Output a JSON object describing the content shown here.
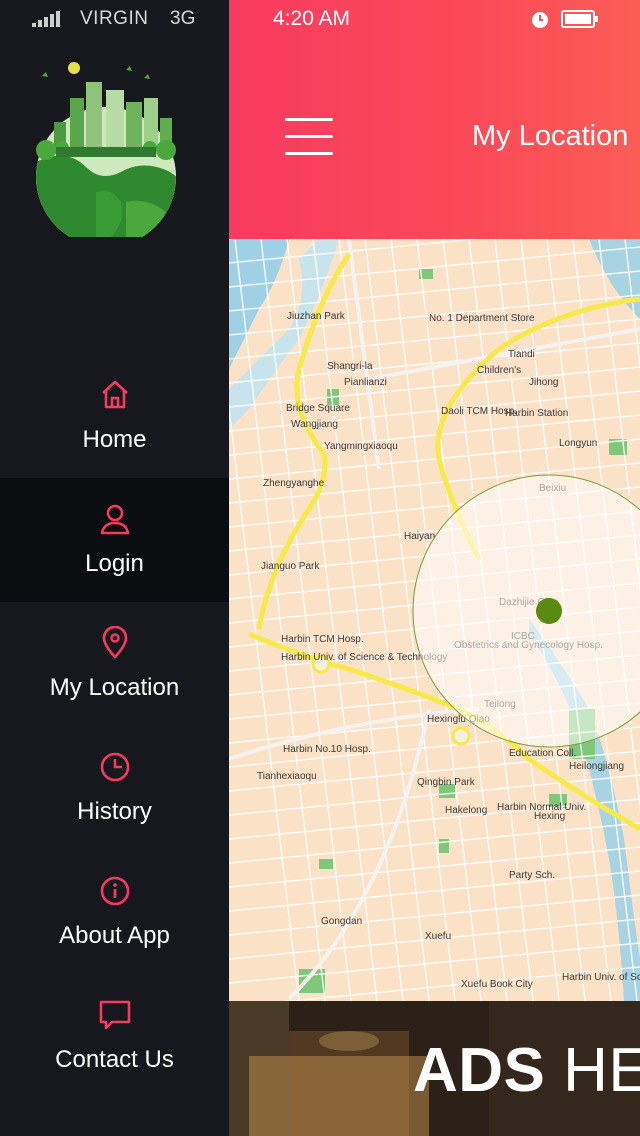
{
  "status_bar": {
    "carrier": "VIRGIN",
    "network": "3G",
    "time": "4:20 AM"
  },
  "header": {
    "title": "My Location",
    "menu_icon": "hamburger-icon"
  },
  "sidebar": {
    "logo": "eco-city-globe-logo",
    "items": [
      {
        "label": "Home",
        "icon": "home-icon",
        "active": false
      },
      {
        "label": "Login",
        "icon": "user-icon",
        "active": true
      },
      {
        "label": "My Location",
        "icon": "location-pin-icon",
        "active": false
      },
      {
        "label": "History",
        "icon": "clock-icon",
        "active": false
      },
      {
        "label": "About App",
        "icon": "info-icon",
        "active": false
      },
      {
        "label": "Contact Us",
        "icon": "chat-icon",
        "active": false
      }
    ]
  },
  "map": {
    "labels": [
      "Jiuzhan Park",
      "Shangri-la",
      "Pianlianzi",
      "Bridge Square",
      "Wangjiang",
      "Daoli TCM Hosp.",
      "Harbin Station",
      "Children's",
      "Jihong",
      "Tiandi",
      "No. 1 Department Store",
      "Longyun",
      "Yangmingxiaoqu",
      "Zhengyanghe",
      "Jianguo Park",
      "Harbin TCM Hosp.",
      "Harbin Univ. of Science & Technology",
      "Haiyan",
      "Beixiu",
      "Dazhijie Qiao",
      "ICBC",
      "Obstetrics and Gynecology Hosp.",
      "Teilong",
      "Harbin No.10 Hosp.",
      "Hexinglu Qiao",
      "Education Coll.",
      "Qingbin Park",
      "Hakelong",
      "Harbin Normal Univ.",
      "Party Sch.",
      "Xuefu Book City",
      "Harbin Univ. of Science & Technolo",
      "Heilongjiang",
      "Tianhexiaoqu",
      "Hexing",
      "Xuefu",
      "Gongdan"
    ]
  },
  "ads": {
    "bold": "ADS",
    "rest": " HERE"
  },
  "colors": {
    "accent": "#f83a5f",
    "sidebar_bg": "#17181d",
    "active_item_bg": "#0c0d10",
    "location_dot": "#5a8a10"
  }
}
